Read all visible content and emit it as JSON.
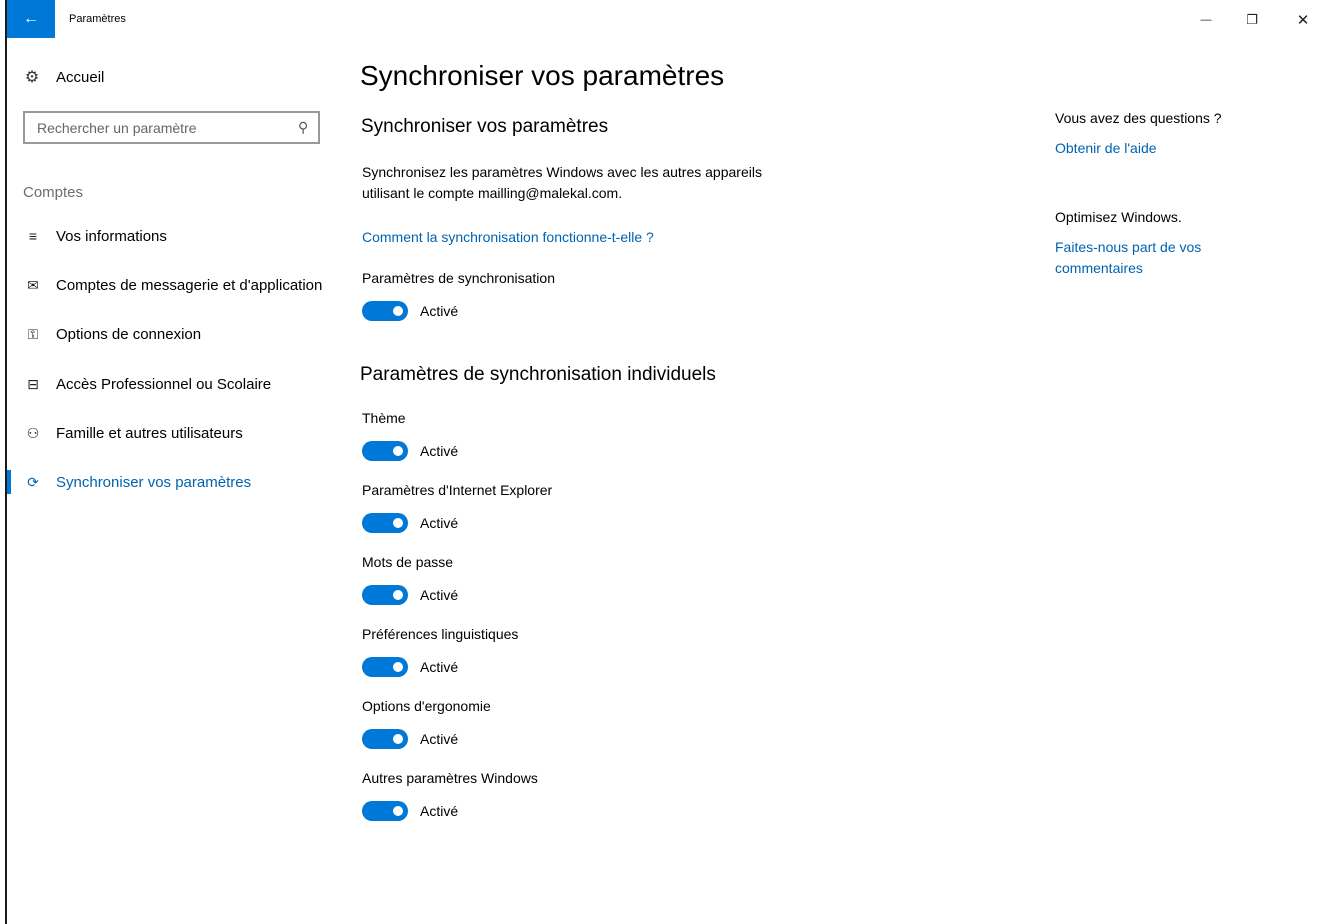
{
  "window": {
    "title": "Paramètres",
    "back_icon": "←",
    "minimize_icon": "—",
    "maximize_icon": "❐",
    "close_icon": "✕",
    "accent_color": "#0078d7"
  },
  "sidebar": {
    "home_label": "Accueil",
    "home_icon": "⚙",
    "search_placeholder": "Rechercher un paramètre",
    "search_icon": "⚲",
    "section_label": "Comptes",
    "items": [
      {
        "label": "Vos informations",
        "icon": "≡"
      },
      {
        "label": "Comptes de messagerie et d'application",
        "icon": "✉"
      },
      {
        "label": "Options de connexion",
        "icon": "⚿"
      },
      {
        "label": "Accès Professionnel ou Scolaire",
        "icon": "⊟"
      },
      {
        "label": "Famille et autres utilisateurs",
        "icon": "⚇"
      },
      {
        "label": "Synchroniser vos paramètres",
        "icon": "⟳",
        "active": true
      }
    ]
  },
  "main": {
    "page_title": "Synchroniser vos paramètres",
    "sub_title": "Synchroniser vos paramètres",
    "description": "Synchronisez les paramètres Windows avec les autres appareils utilisant le compte mailling@malekal.com.",
    "how_link": "Comment la synchronisation fonctionne-t-elle ?",
    "master": {
      "label": "Paramètres de synchronisation",
      "state": "Activé",
      "on": true
    },
    "individual_title": "Paramètres de synchronisation individuels",
    "settings": [
      {
        "label": "Thème",
        "state": "Activé",
        "on": true
      },
      {
        "label": "Paramètres d'Internet Explorer",
        "state": "Activé",
        "on": true
      },
      {
        "label": "Mots de passe",
        "state": "Activé",
        "on": true
      },
      {
        "label": "Préférences linguistiques",
        "state": "Activé",
        "on": true
      },
      {
        "label": "Options d'ergonomie",
        "state": "Activé",
        "on": true
      },
      {
        "label": "Autres paramètres Windows",
        "state": "Activé",
        "on": true
      }
    ]
  },
  "aside": {
    "questions": "Vous avez des questions ?",
    "help_link": "Obtenir de l'aide",
    "optimize": "Optimisez Windows.",
    "feedback_link": "Faites-nous part de vos commentaires"
  }
}
